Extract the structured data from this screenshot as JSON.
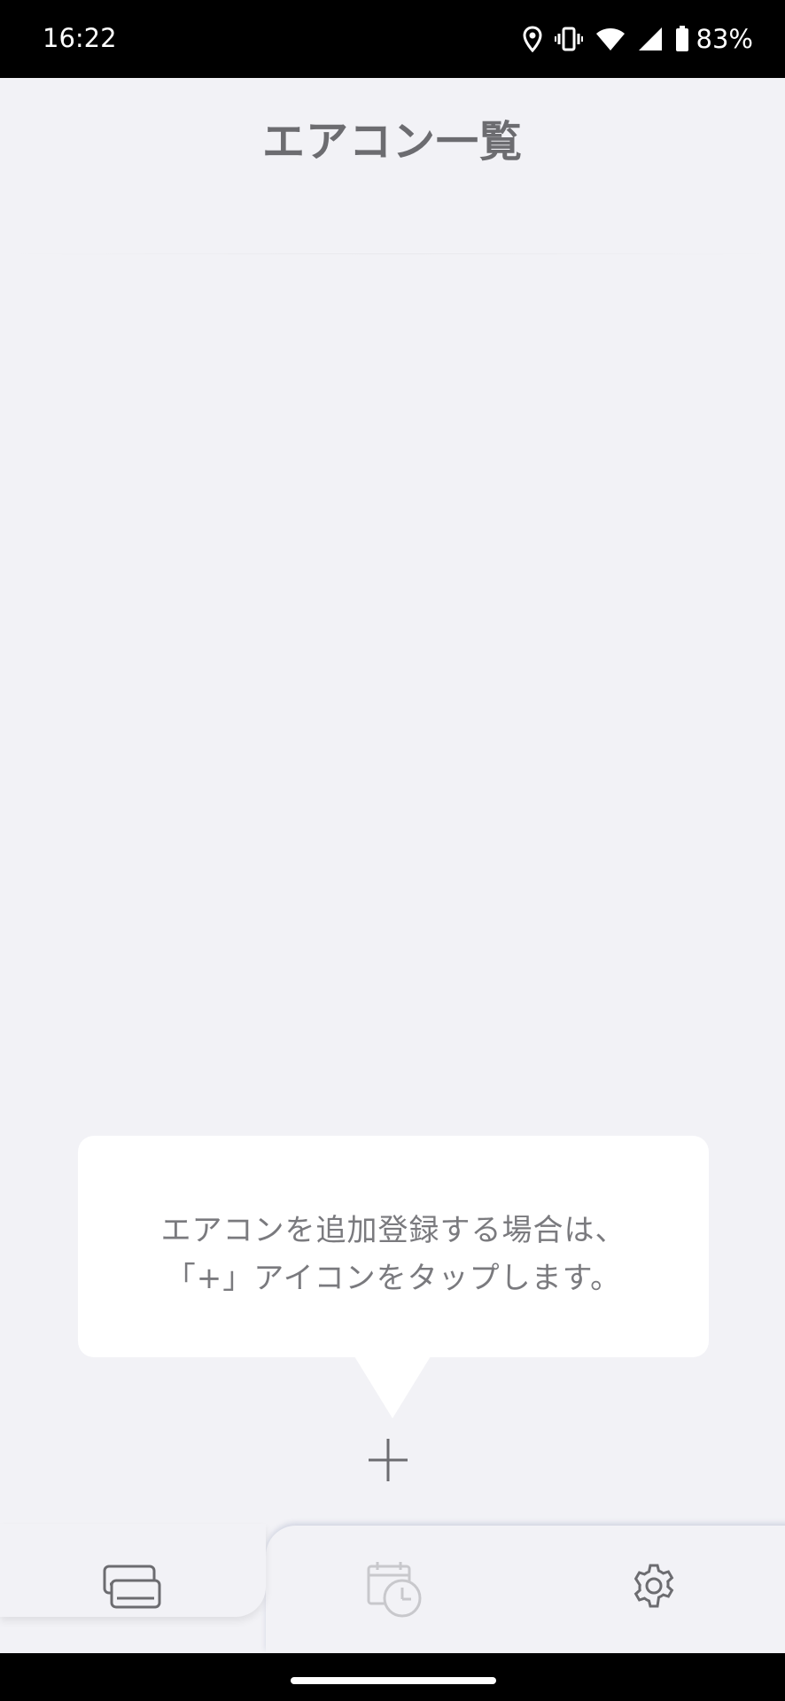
{
  "status_bar": {
    "time": "16:22",
    "icons": [
      "location-icon",
      "vibrate-icon",
      "wifi-icon",
      "signal-icon",
      "battery-icon"
    ],
    "battery_percent": "83%"
  },
  "header": {
    "title": "エアコン一覧"
  },
  "tooltip": {
    "line1": "エアコンを追加登録する場合は、",
    "line2": "「+」アイコンをタップします。"
  },
  "add_button": {
    "icon": "plus-icon"
  },
  "bottom_nav": {
    "tabs": [
      {
        "icon": "aircon-list-icon",
        "active": true
      },
      {
        "icon": "schedule-timer-icon",
        "active": false
      },
      {
        "icon": "gear-icon",
        "active": false
      }
    ]
  },
  "colors": {
    "background": "#f2f2f6",
    "title": "#6c6c70",
    "tooltip_text": "#7a7a7e",
    "icon": "#6c6c70",
    "icon_disabled": "#c8c8cc"
  }
}
